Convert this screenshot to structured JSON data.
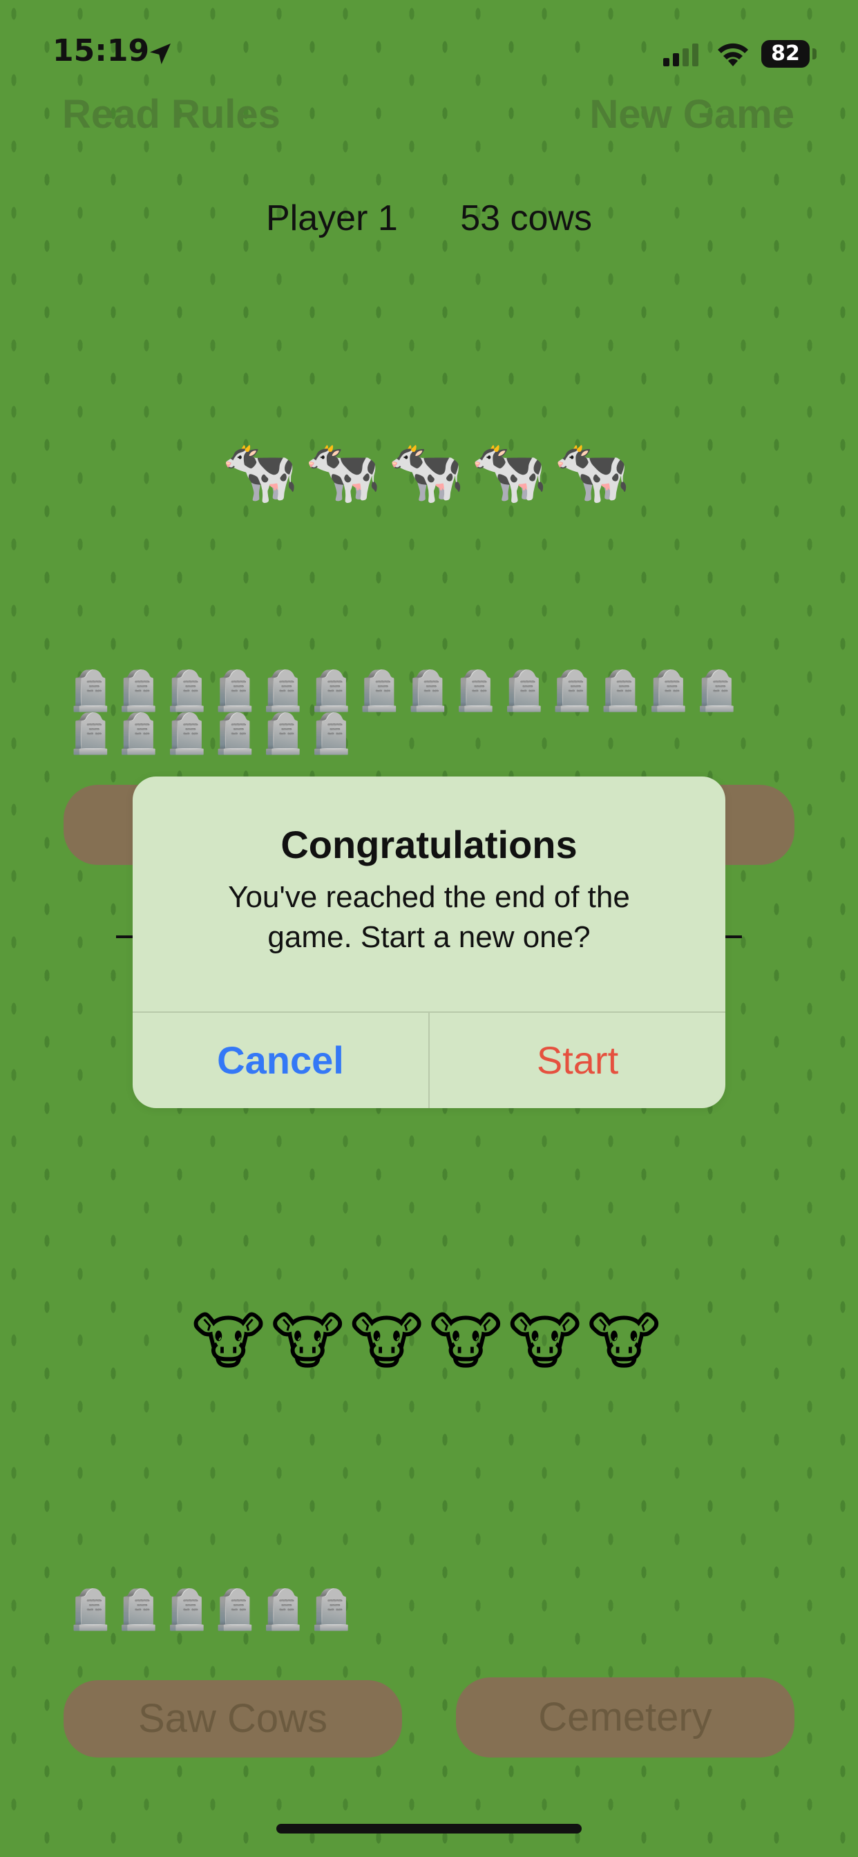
{
  "status_bar": {
    "time": "15:19",
    "battery": "82",
    "icons": [
      "location-arrow-icon",
      "cellular-signal-icon",
      "wifi-icon",
      "battery-icon"
    ]
  },
  "top_buttons": {
    "read_rules": "Read Rules",
    "new_game": "New Game"
  },
  "player": {
    "name": "Player 1",
    "score": "53 cows"
  },
  "rows": {
    "cows": "🐄🐄🐄🐄🐄",
    "graves_top": "🪦🪦🪦🪦🪦🪦🪦🪦🪦🪦🪦🪦🪦🪦🪦🪦🪦🪦🪦🪦",
    "cow_faces": "🐮🐮🐮🐮🐮🐮",
    "graves_bottom": "🪦🪦🪦🪦🪦🪦"
  },
  "bottom_buttons": {
    "saw_cows": "Saw Cows",
    "cemetery": "Cemetery"
  },
  "alert": {
    "title": "Congratulations",
    "message": "You've reached the end of the game. Start a new one?",
    "cancel": "Cancel",
    "start": "Start"
  },
  "colors": {
    "grass": "#5a9a3a",
    "alert_bg": "#d3e6c5",
    "cancel": "#3478f6",
    "start": "#e5513f",
    "pill": "#857053"
  }
}
